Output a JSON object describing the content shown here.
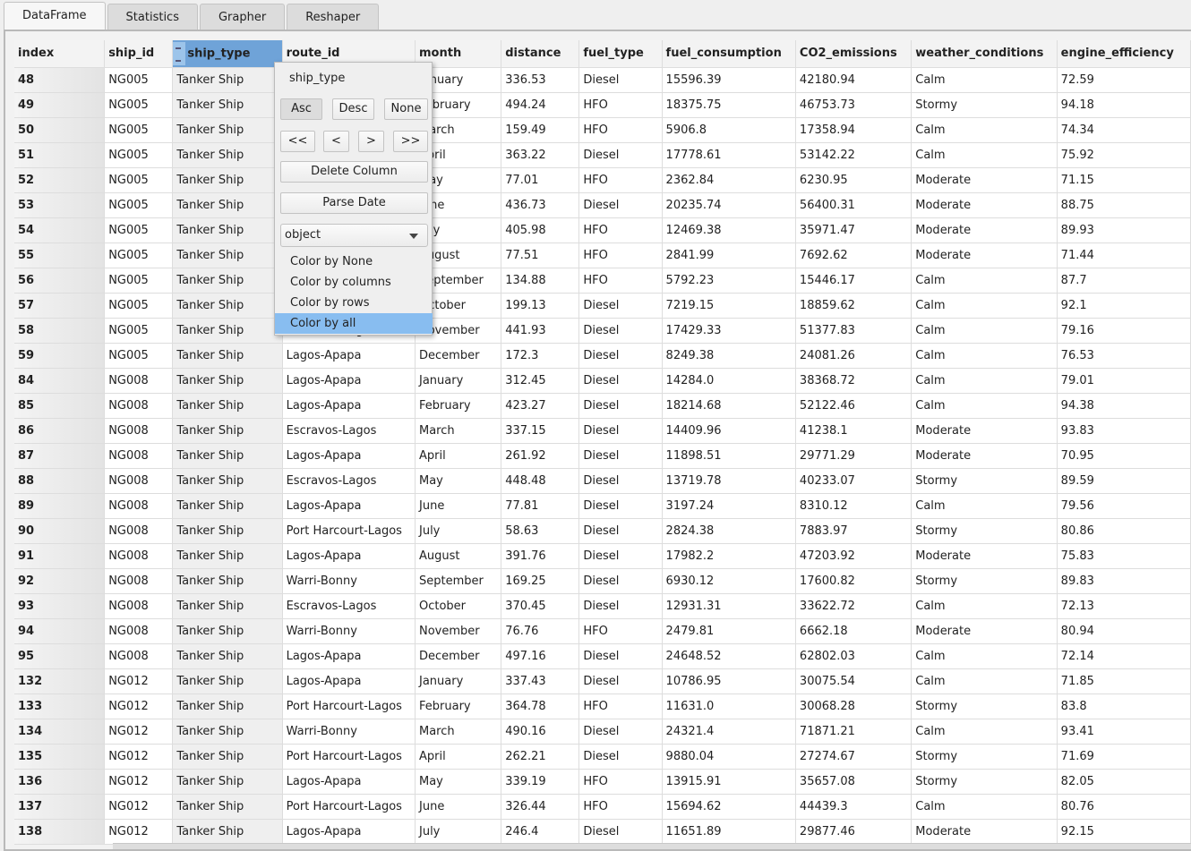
{
  "tabs": [
    "DataFrame",
    "Statistics",
    "Grapher",
    "Reshaper"
  ],
  "columns": [
    "index",
    "ship_id",
    "ship_type",
    "route_id",
    "month",
    "distance",
    "fuel_type",
    "fuel_consumption",
    "CO2_emissions",
    "weather_conditions",
    "engine_efficiency"
  ],
  "rows": [
    [
      "48",
      "NG005",
      "Tanker Ship",
      "",
      "January",
      "336.53",
      "Diesel",
      "15596.39",
      "42180.94",
      "Calm",
      "72.59"
    ],
    [
      "49",
      "NG005",
      "Tanker Ship",
      "",
      "February",
      "494.24",
      "HFO",
      "18375.75",
      "46753.73",
      "Stormy",
      "94.18"
    ],
    [
      "50",
      "NG005",
      "Tanker Ship",
      "",
      "March",
      "159.49",
      "HFO",
      "5906.8",
      "17358.94",
      "Calm",
      "74.34"
    ],
    [
      "51",
      "NG005",
      "Tanker Ship",
      "",
      "April",
      "363.22",
      "Diesel",
      "17778.61",
      "53142.22",
      "Calm",
      "75.92"
    ],
    [
      "52",
      "NG005",
      "Tanker Ship",
      "",
      "May",
      "77.01",
      "HFO",
      "2362.84",
      "6230.95",
      "Moderate",
      "71.15"
    ],
    [
      "53",
      "NG005",
      "Tanker Ship",
      "",
      "June",
      "436.73",
      "Diesel",
      "20235.74",
      "56400.31",
      "Moderate",
      "88.75"
    ],
    [
      "54",
      "NG005",
      "Tanker Ship",
      "",
      "July",
      "405.98",
      "HFO",
      "12469.38",
      "35971.47",
      "Moderate",
      "89.93"
    ],
    [
      "55",
      "NG005",
      "Tanker Ship",
      "",
      "August",
      "77.51",
      "HFO",
      "2841.99",
      "7692.62",
      "Moderate",
      "71.44"
    ],
    [
      "56",
      "NG005",
      "Tanker Ship",
      "",
      "September",
      "134.88",
      "HFO",
      "5792.23",
      "15446.17",
      "Calm",
      "87.7"
    ],
    [
      "57",
      "NG005",
      "Tanker Ship",
      "",
      "October",
      "199.13",
      "Diesel",
      "7219.15",
      "18859.62",
      "Calm",
      "92.1"
    ],
    [
      "58",
      "NG005",
      "Tanker Ship",
      "Escravos-Lagos",
      "November",
      "441.93",
      "Diesel",
      "17429.33",
      "51377.83",
      "Calm",
      "79.16"
    ],
    [
      "59",
      "NG005",
      "Tanker Ship",
      "Lagos-Apapa",
      "December",
      "172.3",
      "Diesel",
      "8249.38",
      "24081.26",
      "Calm",
      "76.53"
    ],
    [
      "84",
      "NG008",
      "Tanker Ship",
      "Lagos-Apapa",
      "January",
      "312.45",
      "Diesel",
      "14284.0",
      "38368.72",
      "Calm",
      "79.01"
    ],
    [
      "85",
      "NG008",
      "Tanker Ship",
      "Lagos-Apapa",
      "February",
      "423.27",
      "Diesel",
      "18214.68",
      "52122.46",
      "Calm",
      "94.38"
    ],
    [
      "86",
      "NG008",
      "Tanker Ship",
      "Escravos-Lagos",
      "March",
      "337.15",
      "Diesel",
      "14409.96",
      "41238.1",
      "Moderate",
      "93.83"
    ],
    [
      "87",
      "NG008",
      "Tanker Ship",
      "Lagos-Apapa",
      "April",
      "261.92",
      "Diesel",
      "11898.51",
      "29771.29",
      "Moderate",
      "70.95"
    ],
    [
      "88",
      "NG008",
      "Tanker Ship",
      "Escravos-Lagos",
      "May",
      "448.48",
      "Diesel",
      "13719.78",
      "40233.07",
      "Stormy",
      "89.59"
    ],
    [
      "89",
      "NG008",
      "Tanker Ship",
      "Lagos-Apapa",
      "June",
      "77.81",
      "Diesel",
      "3197.24",
      "8310.12",
      "Calm",
      "79.56"
    ],
    [
      "90",
      "NG008",
      "Tanker Ship",
      "Port Harcourt-Lagos",
      "July",
      "58.63",
      "Diesel",
      "2824.38",
      "7883.97",
      "Stormy",
      "80.86"
    ],
    [
      "91",
      "NG008",
      "Tanker Ship",
      "Lagos-Apapa",
      "August",
      "391.76",
      "Diesel",
      "17982.2",
      "47203.92",
      "Moderate",
      "75.83"
    ],
    [
      "92",
      "NG008",
      "Tanker Ship",
      "Warri-Bonny",
      "September",
      "169.25",
      "Diesel",
      "6930.12",
      "17600.82",
      "Stormy",
      "89.83"
    ],
    [
      "93",
      "NG008",
      "Tanker Ship",
      "Escravos-Lagos",
      "October",
      "370.45",
      "Diesel",
      "12931.31",
      "33622.72",
      "Calm",
      "72.13"
    ],
    [
      "94",
      "NG008",
      "Tanker Ship",
      "Warri-Bonny",
      "November",
      "76.76",
      "HFO",
      "2479.81",
      "6662.18",
      "Moderate",
      "80.94"
    ],
    [
      "95",
      "NG008",
      "Tanker Ship",
      "Lagos-Apapa",
      "December",
      "497.16",
      "Diesel",
      "24648.52",
      "62802.03",
      "Calm",
      "72.14"
    ],
    [
      "132",
      "NG012",
      "Tanker Ship",
      "Lagos-Apapa",
      "January",
      "337.43",
      "Diesel",
      "10786.95",
      "30075.54",
      "Calm",
      "71.85"
    ],
    [
      "133",
      "NG012",
      "Tanker Ship",
      "Port Harcourt-Lagos",
      "February",
      "364.78",
      "HFO",
      "11631.0",
      "30068.28",
      "Stormy",
      "83.8"
    ],
    [
      "134",
      "NG012",
      "Tanker Ship",
      "Warri-Bonny",
      "March",
      "490.16",
      "Diesel",
      "24321.4",
      "71871.21",
      "Calm",
      "93.41"
    ],
    [
      "135",
      "NG012",
      "Tanker Ship",
      "Port Harcourt-Lagos",
      "April",
      "262.21",
      "Diesel",
      "9880.04",
      "27274.67",
      "Stormy",
      "71.69"
    ],
    [
      "136",
      "NG012",
      "Tanker Ship",
      "Lagos-Apapa",
      "May",
      "339.19",
      "HFO",
      "13915.91",
      "35657.08",
      "Stormy",
      "82.05"
    ],
    [
      "137",
      "NG012",
      "Tanker Ship",
      "Port Harcourt-Lagos",
      "June",
      "326.44",
      "HFO",
      "15694.62",
      "44439.3",
      "Calm",
      "80.76"
    ],
    [
      "138",
      "NG012",
      "Tanker Ship",
      "Lagos-Apapa",
      "July",
      "246.4",
      "Diesel",
      "11651.89",
      "29877.46",
      "Moderate",
      "92.15"
    ]
  ],
  "popup": {
    "title": "ship_type",
    "asc": "Asc",
    "desc": "Desc",
    "none": "None",
    "first": "<<",
    "prev": "<",
    "next": ">",
    "last": ">>",
    "delete": "Delete Column",
    "parse": "Parse Date",
    "dtype": "object",
    "menu": [
      "Color by None",
      "Color by columns",
      "Color by rows",
      "Color by all"
    ],
    "highlighted": "Color by all"
  },
  "colors": {
    "selected_header": "#6fa3d8",
    "menu_highlight": "#88bdf0"
  }
}
